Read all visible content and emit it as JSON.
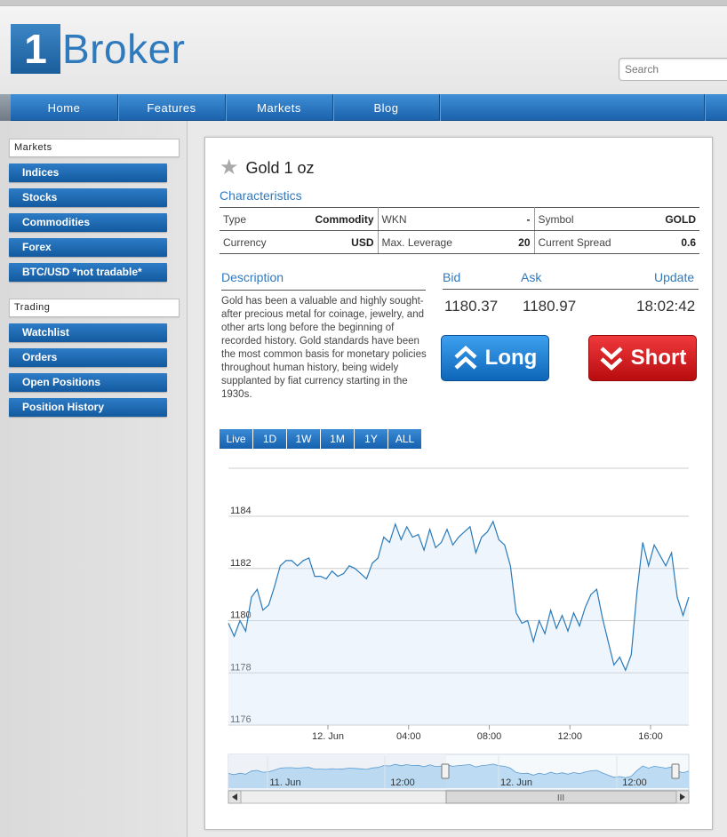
{
  "brand": {
    "logo_digit": "1",
    "logo_word": "Broker"
  },
  "search": {
    "placeholder": "Search"
  },
  "nav": {
    "items": [
      "Home",
      "Features",
      "Markets",
      "Blog"
    ]
  },
  "sidebar": {
    "markets_header": "Markets",
    "markets_items": [
      "Indices",
      "Stocks",
      "Commodities",
      "Forex",
      "BTC/USD *not tradable*"
    ],
    "trading_header": "Trading",
    "trading_items": [
      "Watchlist",
      "Orders",
      "Open Positions",
      "Position History"
    ]
  },
  "asset": {
    "title": "Gold 1 oz",
    "star_icon": "star-icon"
  },
  "characteristics": {
    "label": "Characteristics",
    "row1": {
      "type_label": "Type",
      "type_value": "Commodity",
      "wkn_label": "WKN",
      "wkn_value": "-",
      "symbol_label": "Symbol",
      "symbol_value": "GOLD"
    },
    "row2": {
      "currency_label": "Currency",
      "currency_value": "USD",
      "leverage_label": "Max. Leverage",
      "leverage_value": "20",
      "spread_label": "Current Spread",
      "spread_value": "0.6"
    }
  },
  "description": {
    "label": "Description",
    "text": "Gold has been a valuable and highly sought-after precious metal for coinage, jewelry, and other arts long before the beginning of recorded history. Gold standards have been the most common basis for monetary policies throughout human history, being widely supplanted by fiat currency starting in the 1930s."
  },
  "quote": {
    "bid_label": "Bid",
    "ask_label": "Ask",
    "update_label": "Update",
    "bid": "1180.37",
    "ask": "1180.97",
    "update": "18:02:42"
  },
  "actions": {
    "long_label": "Long",
    "short_label": "Short",
    "long_color": "#1a7bd0",
    "short_color": "#d81e21"
  },
  "ranges": [
    "Live",
    "1D",
    "1W",
    "1M",
    "1Y",
    "ALL"
  ],
  "chart_data": {
    "type": "line",
    "x_tick_labels": [
      "12. Jun",
      "04:00",
      "08:00",
      "12:00",
      "16:00"
    ],
    "y_tick_labels": [
      "1176",
      "1178",
      "1180",
      "1182",
      "1184"
    ],
    "ylim": [
      1176,
      1184
    ],
    "series": [
      {
        "values": [
          1179.9,
          1179.4,
          1180.0,
          1179.6,
          1180.9,
          1181.2,
          1180.4,
          1180.6,
          1181.3,
          1182.1,
          1182.3,
          1182.3,
          1182.1,
          1182.3,
          1182.4,
          1181.7,
          1181.7,
          1181.6,
          1181.9,
          1181.7,
          1181.8,
          1182.1,
          1182.0,
          1181.8,
          1181.6,
          1182.2,
          1182.4,
          1183.2,
          1183.0,
          1183.7,
          1183.1,
          1183.6,
          1183.2,
          1183.3,
          1182.7,
          1183.5,
          1182.8,
          1183.0,
          1183.5,
          1182.9,
          1183.2,
          1183.4,
          1183.6,
          1182.6,
          1183.2,
          1183.4,
          1183.8,
          1183.1,
          1182.9,
          1182.1,
          1180.3,
          1179.9,
          1180.0,
          1179.2,
          1180.0,
          1179.5,
          1180.4,
          1179.7,
          1180.2,
          1179.6,
          1180.3,
          1179.8,
          1180.5,
          1181.0,
          1181.2,
          1180.1,
          1179.2,
          1178.3,
          1178.6,
          1178.1,
          1178.7,
          1181.1,
          1183.0,
          1182.1,
          1182.9,
          1182.5,
          1182.1,
          1182.6,
          1180.9,
          1180.2,
          1180.9
        ]
      }
    ],
    "navigator": {
      "x_tick_labels": [
        "11. Jun",
        "12:00",
        "12. Jun",
        "12:00"
      ]
    }
  }
}
